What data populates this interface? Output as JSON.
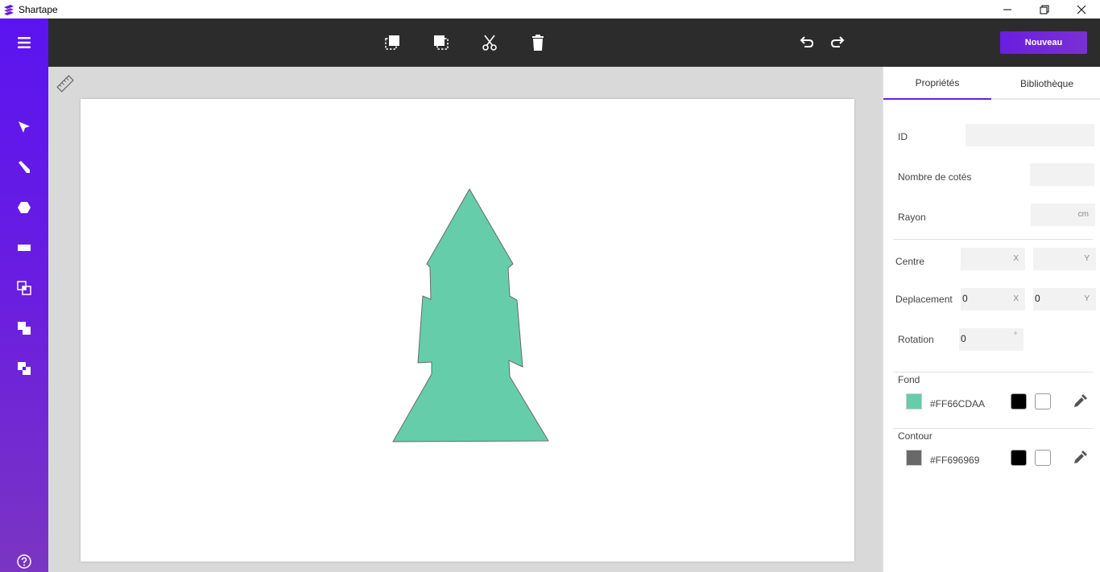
{
  "window": {
    "title": "Shartape",
    "controls": [
      "minimize-icon",
      "restore-icon",
      "close-icon"
    ]
  },
  "sidebar": {
    "items": [
      "menu-icon",
      "select-icon",
      "pencil-icon",
      "hexagon-icon",
      "rectangle-icon",
      "group-icon",
      "merge-icon",
      "intersect-icon",
      "help-icon"
    ]
  },
  "toolbar": {
    "tools": [
      "copy-icon",
      "paste-icon",
      "cut-icon",
      "delete-icon",
      "undo-icon",
      "redo-icon"
    ],
    "new_label": "Nouveau"
  },
  "canvas": {
    "shape": {
      "fill": "#66CDAA",
      "stroke": "#696969"
    }
  },
  "panel": {
    "tabs": [
      {
        "label": "Propriétés",
        "active": true
      },
      {
        "label": "Bibliothèque",
        "active": false
      }
    ],
    "id_label": "ID",
    "id_value": "",
    "sides_label": "Nombre de cotés",
    "sides_value": "",
    "radius_label": "Rayon",
    "radius_unit": "cm",
    "center_label": "Centre",
    "center_x_unit": "X",
    "center_y_unit": "Y",
    "move_label": "Deplacement",
    "move_x": "0",
    "move_y": "0",
    "move_x_unit": "X",
    "move_y_unit": "Y",
    "rotation_label": "Rotation",
    "rotation_value": "0",
    "rotation_unit": "°",
    "fill_label": "Fond",
    "fill_hex": "#FF66CDAA",
    "fill_color": "#66CDAA",
    "stroke_label": "Contour",
    "stroke_hex": "#FF696969",
    "stroke_color": "#696969",
    "accent_color": "#6A1EE0"
  }
}
